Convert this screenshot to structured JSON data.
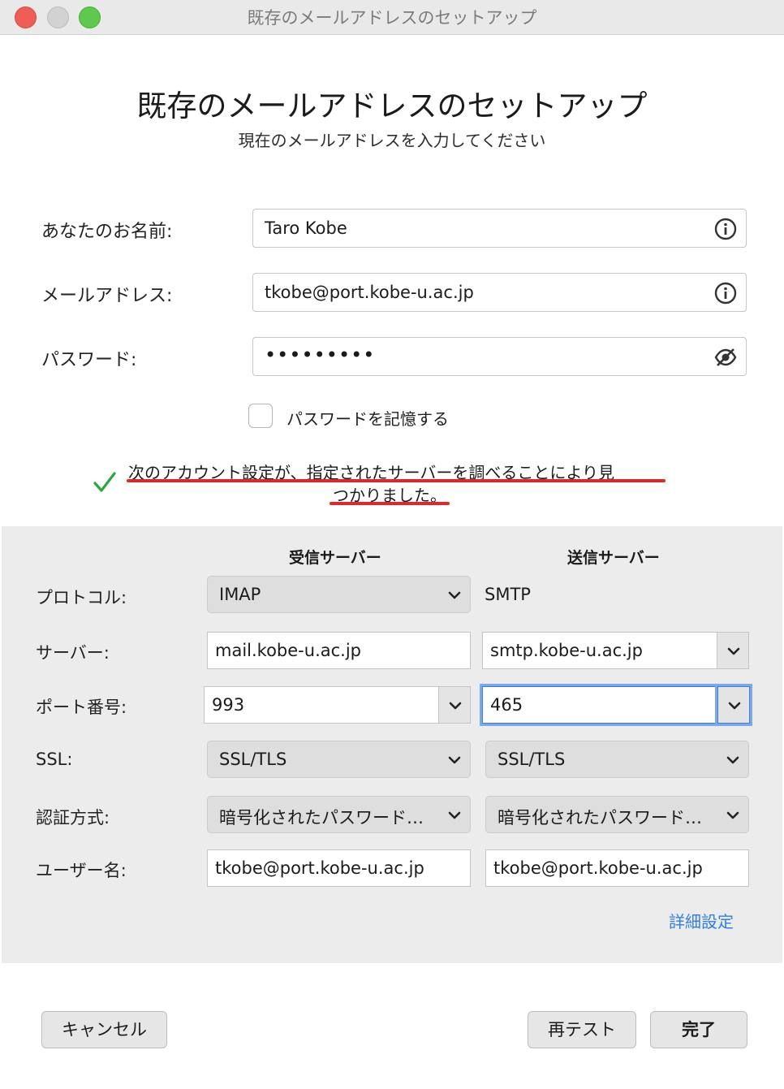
{
  "window": {
    "title": "既存のメールアドレスのセットアップ"
  },
  "header": {
    "title": "既存のメールアドレスのセットアップ",
    "subtitle": "現在のメールアドレスを入力してください"
  },
  "form": {
    "name_label": "あなたのお名前:",
    "name_value": "Taro Kobe",
    "email_label": "メールアドレス:",
    "email_value": "tkobe@port.kobe-u.ac.jp",
    "password_label": "パスワード:",
    "password_value": "•••••••••",
    "remember_label": "パスワードを記憶する",
    "remember_checked": false
  },
  "status": {
    "line1": "次のアカウント設定が、指定されたサーバーを調べることにより見",
    "line2": "つかりました。",
    "highlight_color": "#e3262b"
  },
  "servers": {
    "incoming_header": "受信サーバー",
    "outgoing_header": "送信サーバー",
    "protocol_label": "プロトコル:",
    "protocol_in": "IMAP",
    "protocol_out": "SMTP",
    "server_label": "サーバー:",
    "server_in": "mail.kobe-u.ac.jp",
    "server_out": "smtp.kobe-u.ac.jp",
    "port_label": "ポート番号:",
    "port_in": "993",
    "port_out": "465",
    "ssl_label": "SSL:",
    "ssl_in": "SSL/TLS",
    "ssl_out": "SSL/TLS",
    "auth_label": "認証方式:",
    "auth_in": "暗号化されたパスワード…",
    "auth_out": "暗号化されたパスワード…",
    "user_label": "ユーザー名:",
    "user_in": "tkobe@port.kobe-u.ac.jp",
    "user_out": "tkobe@port.kobe-u.ac.jp",
    "advanced_link": "詳細設定"
  },
  "buttons": {
    "cancel": "キャンセル",
    "retest": "再テスト",
    "done": "完了"
  },
  "colors": {
    "accent": "#2f7fe3",
    "check_green": "#2aa83a",
    "focus": "#3f7fdc"
  }
}
